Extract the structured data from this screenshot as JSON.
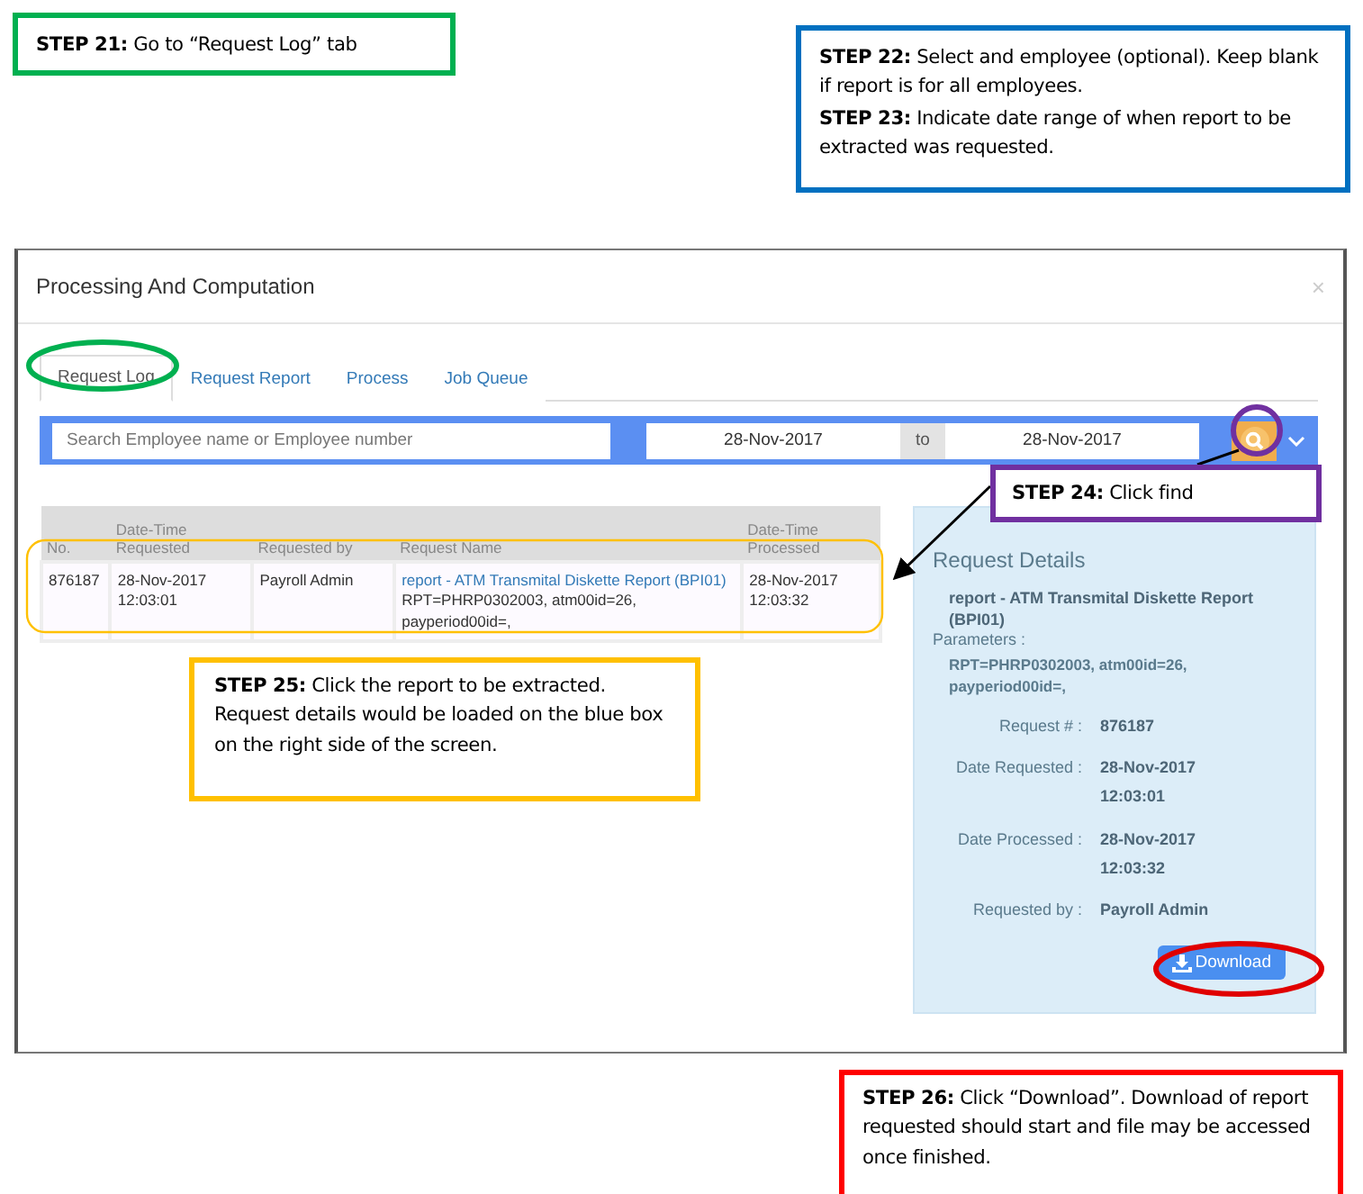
{
  "callouts": [
    {
      "color": "#00b050",
      "lines": [
        "**STEP 21:** Go to “Request Log” tab"
      ]
    },
    {
      "color": "#0070c0",
      "lines": [
        "**STEP 22:** Select and employee (optional). Keep blank if report is for all employees.",
        "**STEP 23:** Indicate date range of when report to be extracted was requested."
      ]
    },
    {
      "color": "#7030a0",
      "lines": [
        "**STEP 24:** Click find"
      ]
    },
    {
      "color": "#ffc000",
      "lines": [
        "**STEP 25:** Click the report to be extracted. Request details would be loaded on the blue box on the right side of the screen."
      ]
    },
    {
      "color": "#ff0000",
      "lines": [
        "**STEP 26:** Click “Download”. Download of report requested should start and file may be accessed once finished."
      ]
    }
  ],
  "dialog": {
    "title": "Processing And Computation",
    "close": "×",
    "tabs": [
      {
        "label": "Request Log",
        "selected": true
      },
      {
        "label": "Request Report",
        "selected": false
      },
      {
        "label": "Process",
        "selected": false
      },
      {
        "label": "Job Queue",
        "selected": false
      }
    ],
    "search": {
      "placeholder": "Search Employee name or Employee number",
      "date_from": "28-Nov-2017",
      "separator": "to",
      "date_to": "28-Nov-2017"
    },
    "table": {
      "columns": [
        "No.",
        "Date-Time Requested",
        "Requested by",
        "Request Name",
        "Date-Time Processed"
      ],
      "rows": [
        {
          "selected": true,
          "cells": [
            "876187",
            "28-Nov-2017 12:03:01",
            "Payroll Admin",
            {
              "link": "report - ATM Transmital Diskette Report (BPI01)",
              "text": "RPT=PHRP0302003, atm00id=26, payperiod00id=,"
            },
            "28-Nov-2017 12:03:32"
          ]
        }
      ]
    },
    "details": {
      "title": "Request Details",
      "report": "report - ATM Transmital Diskette Report (BPI01)",
      "parameters_label": "Parameters :",
      "parameters": "RPT=PHRP0302003, atm00id=26, payperiod00id=,",
      "fields": [
        {
          "label": "Request # :",
          "value": "876187"
        },
        {
          "label": "Date Requested :",
          "value": "28-Nov-2017 12:03:01"
        },
        {
          "label": "Date Processed :",
          "value": "28-Nov-2017 12:03:32"
        },
        {
          "label": "Requested by :",
          "value": "Payroll Admin"
        }
      ],
      "download": "Download"
    }
  }
}
